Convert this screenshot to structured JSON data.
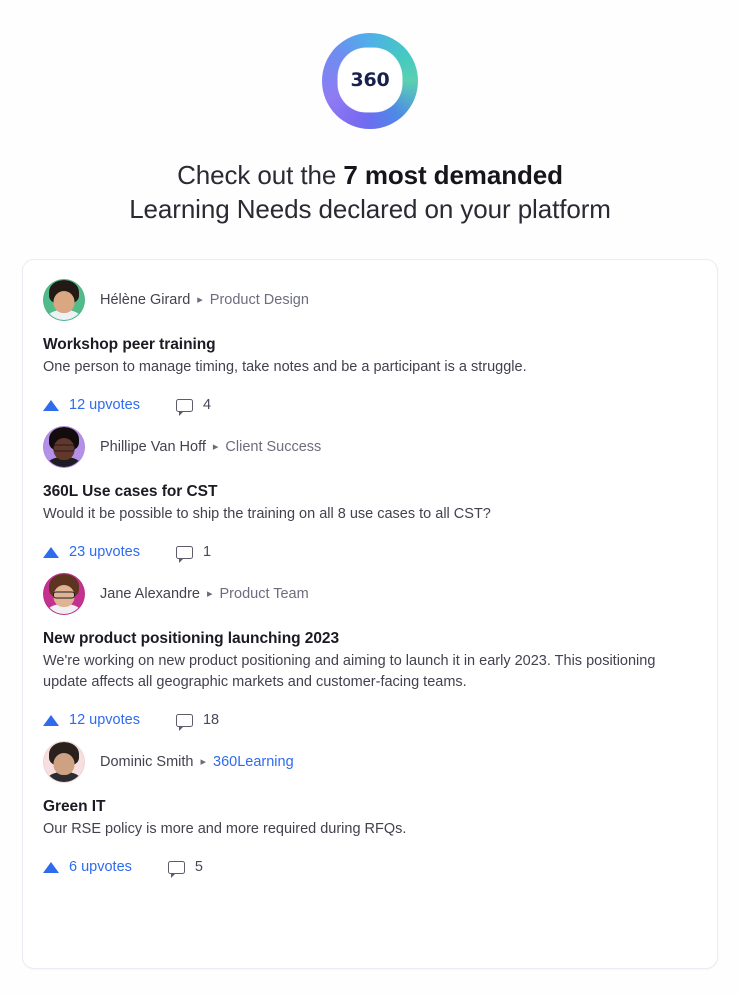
{
  "brand": {
    "logo_text": "360",
    "logo_icon": "360-ring-logo-icon"
  },
  "heading": {
    "line1_prefix": "Check out the ",
    "line1_bold": "7 most demanded",
    "line2": "Learning Needs declared on your platform"
  },
  "colors": {
    "accent_blue": "#2f6bed",
    "text_dark": "#1b1b23",
    "text_muted": "#6d6d80",
    "card_border": "#eceaf2",
    "page_bg": "#fefefe"
  },
  "feed": {
    "posts": [
      {
        "author": "Hélène Girard",
        "separator": "▸",
        "category": "Product Design",
        "category_is_link": false,
        "title": "Workshop peer training",
        "body": "One person to manage timing, take notes and be a participant is a struggle.",
        "upvotes_label": "12 upvotes",
        "comments": "4",
        "avatar": {
          "bg": "#52bb8b",
          "hair": "#231a16",
          "skin": "#d9a782",
          "clothes": "#eef2f4",
          "glasses": false
        }
      },
      {
        "author": "Phillipe Van Hoff",
        "separator": "▸",
        "category": "Client Success",
        "category_is_link": false,
        "title": "360L Use cases for CST",
        "body": "Would it be possible to ship the training on all 8 use cases to all CST?",
        "upvotes_label": "23 upvotes",
        "comments": "1",
        "avatar": {
          "bg": "#b490e8",
          "hair": "#120d0c",
          "skin": "#63382a",
          "clothes": "#1d1c22",
          "glasses": true
        }
      },
      {
        "author": "Jane Alexandre",
        "separator": "▸",
        "category": "Product Team",
        "category_is_link": false,
        "title": "New product positioning launching 2023",
        "body": "We're working on new product positioning and aiming to launch it in early 2023. This positioning update affects all geographic markets and customer-facing teams.",
        "upvotes_label": "12 upvotes",
        "comments": "18",
        "avatar": {
          "bg": "#c4328f",
          "hair": "#5d3420",
          "skin": "#e0b395",
          "clothes": "#f0f0f2",
          "glasses": true
        }
      },
      {
        "author": "Dominic Smith",
        "separator": "▸",
        "category": "360Learning",
        "category_is_link": true,
        "title": "Green IT",
        "body": "Our RSE policy is more and more required during RFQs.",
        "upvotes_label": "6 upvotes",
        "comments": "5",
        "avatar": {
          "bg": "#f7dfe0",
          "hair": "#2a211c",
          "skin": "#cfa183",
          "clothes": "#2c2b31",
          "glasses": false
        }
      }
    ]
  }
}
